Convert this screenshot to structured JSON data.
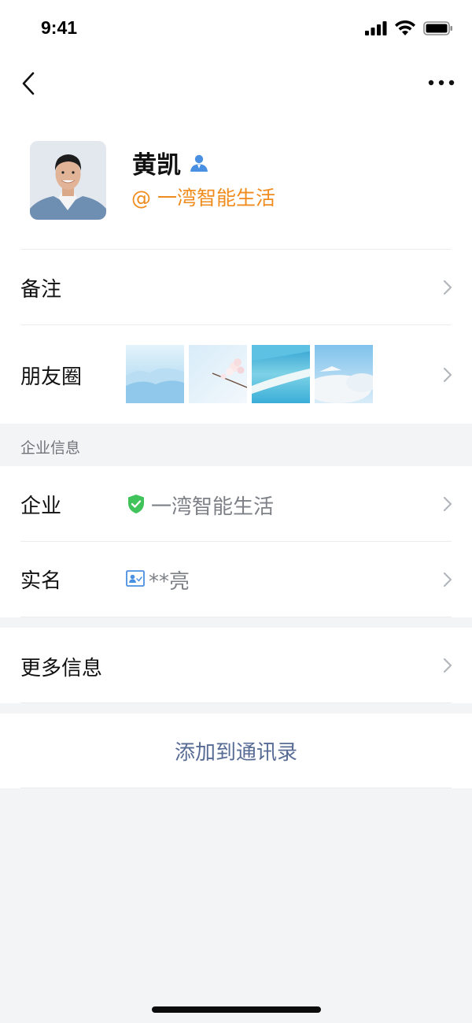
{
  "status_bar": {
    "time": "9:41"
  },
  "profile": {
    "name": "黄凯",
    "company_tag": "@ 一湾智能生活"
  },
  "rows": {
    "remark_label": "备注",
    "moments_label": "朋友圈"
  },
  "section": {
    "enterprise_info_header": "企业信息"
  },
  "enterprise": {
    "company_label": "企业",
    "company_value": "一湾智能生活",
    "realname_label": "实名",
    "realname_value": "**亮"
  },
  "more": {
    "more_info_label": "更多信息"
  },
  "actions": {
    "add_to_contacts": "添加到通讯录"
  },
  "colors": {
    "accent_orange": "#f08c1e",
    "link_blue": "#576b95",
    "shield_green": "#3fc35a",
    "contact_icon_blue": "#4a90e2"
  },
  "icons": [
    "back-arrow-icon",
    "more-dots-icon",
    "signal-icon",
    "wifi-icon",
    "battery-icon",
    "contact-person-icon",
    "chevron-right-icon",
    "verified-shield-icon",
    "id-card-icon"
  ]
}
